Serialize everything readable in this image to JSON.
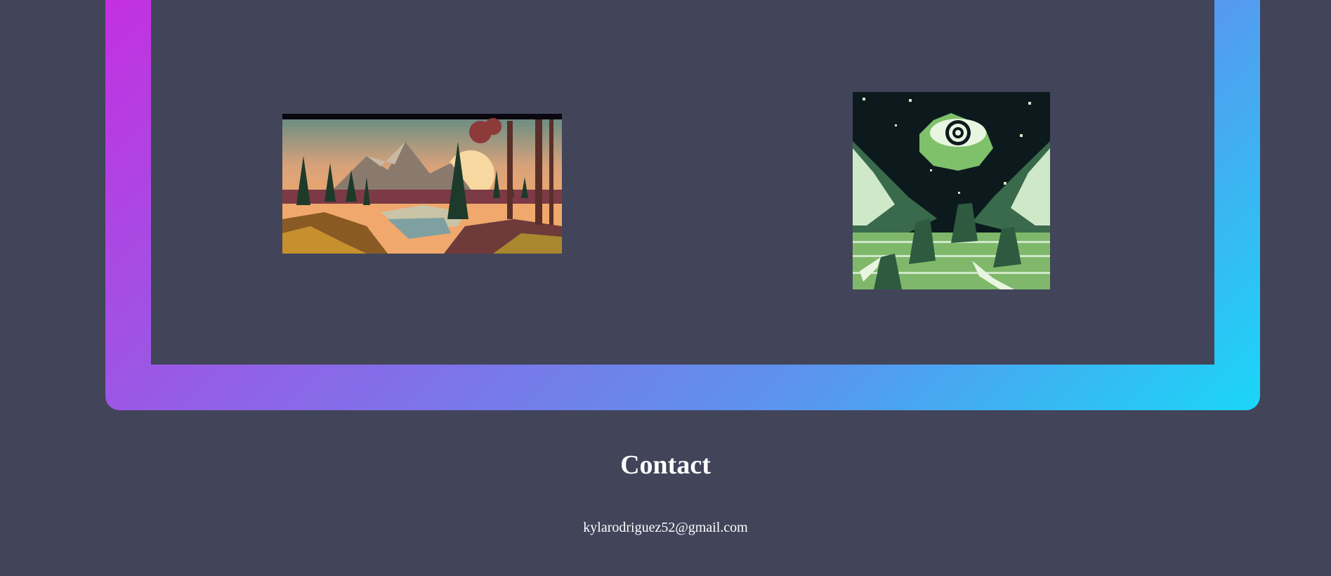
{
  "gallery": {
    "frame_gradient": [
      "#c62de0",
      "#1ad6f7"
    ],
    "images": [
      {
        "name": "pixel-forest-lake-sunset"
      },
      {
        "name": "pixel-eye-over-mountains"
      }
    ]
  },
  "contact": {
    "title": "Contact",
    "email": "kylarodriguez52@gmail.com"
  }
}
